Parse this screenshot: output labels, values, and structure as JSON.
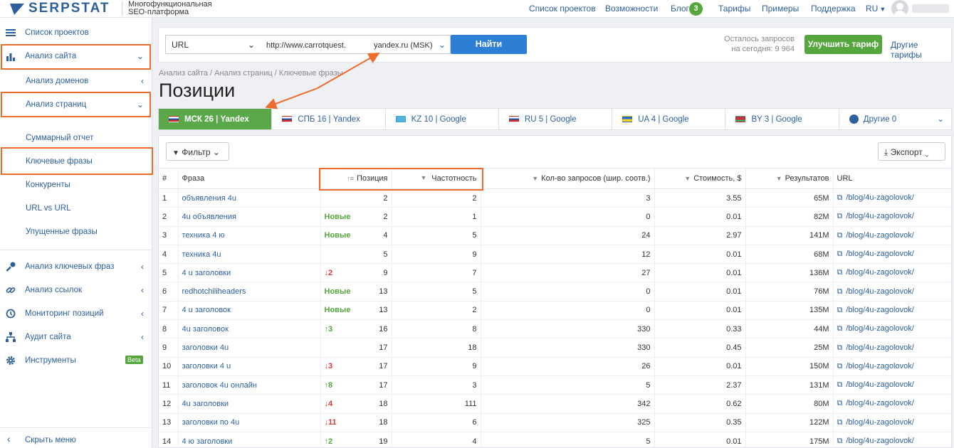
{
  "brand": {
    "name": "SERPSTAT",
    "tagline": "Многофункциональная SEO-платформа"
  },
  "topnav": {
    "items": [
      "Список проектов",
      "Возможности",
      "Блог",
      "Тарифы",
      "Примеры",
      "Поддержка"
    ],
    "blog_badge": "3",
    "lang": "RU"
  },
  "sidebar": {
    "projects": "Список проектов",
    "site_analysis": "Анализ сайта",
    "domain_analysis": "Анализ доменов",
    "page_analysis": "Анализ страниц",
    "summary": "Суммарный отчет",
    "keywords": "Ключевые фразы",
    "competitors": "Конкуренты",
    "url_vs_url": "URL vs URL",
    "missed": "Упущенные фразы",
    "keyword_research": "Анализ ключевых фраз",
    "links": "Анализ ссылок",
    "rank_tracker": "Мониторинг позиций",
    "audit": "Аудит сайта",
    "tools": "Инструменты",
    "tools_badge": "Beta",
    "hide": "Скрыть меню"
  },
  "search": {
    "type": "URL",
    "query": "http://www.carrotquest.",
    "engine": "yandex.ru (MSK)",
    "find": "Найти",
    "remaining_line1": "Осталось запросов",
    "remaining_line2": "на сегодня: 9 964",
    "upgrade": "Улучшить тариф",
    "other_plans": "Другие тарифы"
  },
  "breadcrumb": "Анализ сайта / Анализ страниц / Ключевые фразы",
  "title": "Позиции",
  "tabs": [
    {
      "label": "МСК 26 | Yandex",
      "flag": "ru"
    },
    {
      "label": "СПБ 16 | Yandex",
      "flag": "ru"
    },
    {
      "label": "KZ 10 | Google",
      "flag": "kz"
    },
    {
      "label": "RU 5 | Google",
      "flag": "ru"
    },
    {
      "label": "UA 4 | Google",
      "flag": "ua"
    },
    {
      "label": "BY 3 | Google",
      "flag": "by"
    },
    {
      "label": "Другие 0",
      "flag": "globe"
    }
  ],
  "toolbar": {
    "filter": "Фильтр",
    "export": "Экспорт"
  },
  "table": {
    "headers": [
      "#",
      "Фраза",
      "Позиция",
      "Частотность",
      "Кол-во запросов (шир. соотв.)",
      "Стоимость, $",
      "Результатов",
      "URL"
    ],
    "rows": [
      {
        "n": "1",
        "phrase": "объявления 4u",
        "change": "",
        "pos": "2",
        "freq": "2",
        "broad": "3",
        "cost": "3.55",
        "results": "65M",
        "url": "/blog/4u-zagolovok/"
      },
      {
        "n": "2",
        "phrase": "4u объявления",
        "change": "Новые",
        "pos": "2",
        "freq": "1",
        "broad": "0",
        "cost": "0.01",
        "results": "82M",
        "url": "/blog/4u-zagolovok/"
      },
      {
        "n": "3",
        "phrase": "техника 4 ю",
        "change": "Новые",
        "pos": "4",
        "freq": "5",
        "broad": "24",
        "cost": "2.97",
        "results": "141M",
        "url": "/blog/4u-zagolovok/"
      },
      {
        "n": "4",
        "phrase": "техника 4u",
        "change": "",
        "pos": "5",
        "freq": "9",
        "broad": "12",
        "cost": "0.01",
        "results": "68M",
        "url": "/blog/4u-zagolovok/"
      },
      {
        "n": "5",
        "phrase": "4 u заголовки",
        "change": "↓2",
        "pos": "9",
        "freq": "7",
        "broad": "27",
        "cost": "0.01",
        "results": "136M",
        "url": "/blog/4u-zagolovok/"
      },
      {
        "n": "6",
        "phrase": "redhotchiliheaders",
        "change": "Новые",
        "pos": "13",
        "freq": "5",
        "broad": "0",
        "cost": "0.01",
        "results": "76M",
        "url": "/blog/4u-zagolovok/"
      },
      {
        "n": "7",
        "phrase": "4 u заголовок",
        "change": "Новые",
        "pos": "13",
        "freq": "2",
        "broad": "0",
        "cost": "0.01",
        "results": "135M",
        "url": "/blog/4u-zagolovok/"
      },
      {
        "n": "8",
        "phrase": "4u заголовок",
        "change": "↑3",
        "pos": "16",
        "freq": "8",
        "broad": "330",
        "cost": "0.33",
        "results": "44M",
        "url": "/blog/4u-zagolovok/"
      },
      {
        "n": "9",
        "phrase": "заголовки 4u",
        "change": "",
        "pos": "17",
        "freq": "18",
        "broad": "330",
        "cost": "0.45",
        "results": "25M",
        "url": "/blog/4u-zagolovok/"
      },
      {
        "n": "10",
        "phrase": "заголовки 4 u",
        "change": "↓3",
        "pos": "17",
        "freq": "9",
        "broad": "26",
        "cost": "0.01",
        "results": "150M",
        "url": "/blog/4u-zagolovok/"
      },
      {
        "n": "11",
        "phrase": "заголовок 4u онлайн",
        "change": "↑8",
        "pos": "17",
        "freq": "3",
        "broad": "5",
        "cost": "2.37",
        "results": "131M",
        "url": "/blog/4u-zagolovok/"
      },
      {
        "n": "12",
        "phrase": "4u заголовки",
        "change": "↓4",
        "pos": "18",
        "freq": "111",
        "broad": "342",
        "cost": "0.62",
        "results": "80M",
        "url": "/blog/4u-zagolovok/"
      },
      {
        "n": "13",
        "phrase": "заголовки по 4u",
        "change": "↓11",
        "pos": "18",
        "freq": "6",
        "broad": "325",
        "cost": "0.35",
        "results": "122M",
        "url": "/blog/4u-zagolovok/"
      },
      {
        "n": "14",
        "phrase": "4 ю заголовки",
        "change": "↑2",
        "pos": "19",
        "freq": "4",
        "broad": "5",
        "cost": "0.01",
        "results": "175M",
        "url": "/blog/4u-zagolovok/"
      }
    ]
  },
  "colors": {
    "brand": "#2c5f9c",
    "green": "#55a63d",
    "red": "#d9383a",
    "highlight": "#ec6b2d",
    "button_blue": "#2d7fd6"
  }
}
